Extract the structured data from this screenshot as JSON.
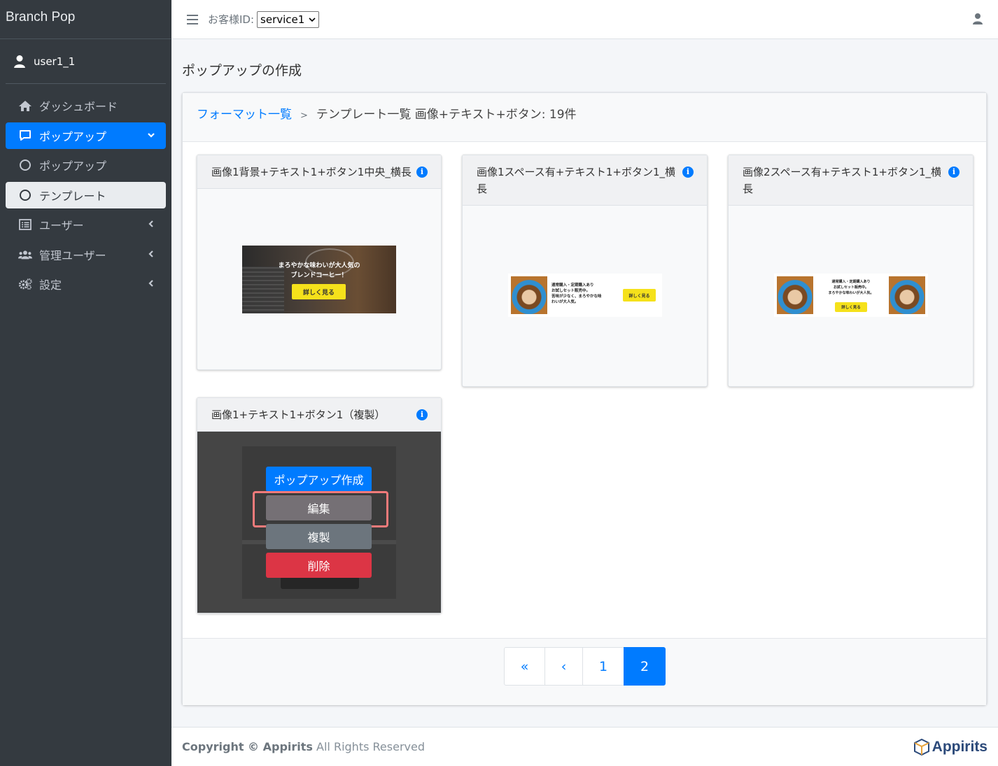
{
  "brand": "Branch Pop",
  "user": "user1_1",
  "sidebar": {
    "items": [
      {
        "label": "ダッシュボード",
        "icon": "home-icon"
      },
      {
        "label": "ポップアップ",
        "icon": "popup-icon"
      },
      {
        "label": "ポップアップ",
        "icon": "circle-icon"
      },
      {
        "label": "テンプレート",
        "icon": "circle-icon"
      },
      {
        "label": "ユーザー",
        "icon": "list-icon"
      },
      {
        "label": "管理ユーザー",
        "icon": "users-icon"
      },
      {
        "label": "設定",
        "icon": "gears-icon"
      }
    ]
  },
  "topbar": {
    "customer_label": "お客様ID:",
    "customer_value": "service1"
  },
  "page_title": "ポップアップの作成",
  "breadcrumb": {
    "link": "フォーマット一覧",
    "separator": ">",
    "current": "テンプレート一覧 画像+テキスト+ボタン: 19件"
  },
  "templates": [
    {
      "title": "画像1背景+テキスト1+ボタン1中央_横長",
      "preview": {
        "line1": "まろやかな味わいが大人気の",
        "line2": "ブレンドコーヒー！",
        "button": "詳しく見る"
      }
    },
    {
      "title": "画像1スペース有+テキスト1+ボタン1_横長",
      "preview": {
        "line1": "通常購入・定期購入あり",
        "line2": "お試しセット販売中。",
        "line3": "苦味が少なく、まろやかな味",
        "line4": "わいが大人気。",
        "button": "詳しく見る"
      }
    },
    {
      "title": "画像2スペース有+テキスト1+ボタン1_横長",
      "preview": {
        "line1": "通常購入・定期購入あり",
        "line2": "お試しセット販売中。",
        "line3": "まろやかな味わいが大人気。",
        "button": "詳しく見る"
      }
    },
    {
      "title": "画像1+テキスト1+ボタン1（複製）",
      "actions": {
        "create": "ポップアップ作成",
        "edit": "編集",
        "duplicate": "複製",
        "delete": "削除"
      }
    }
  ],
  "pagination": {
    "first": "«",
    "prev": "‹",
    "pages": [
      "1",
      "2"
    ],
    "current": "2"
  },
  "footer": {
    "prefix": "Copyright © ",
    "company": "Appirits",
    "suffix": " All Rights Reserved",
    "logo": "Appirits"
  },
  "colors": {
    "primary": "#007bff",
    "danger": "#dc3545",
    "secondary": "#6c757d",
    "sidebar": "#343a40",
    "highlight": "#f07a7a",
    "preview_yellow": "#f5e11b"
  }
}
